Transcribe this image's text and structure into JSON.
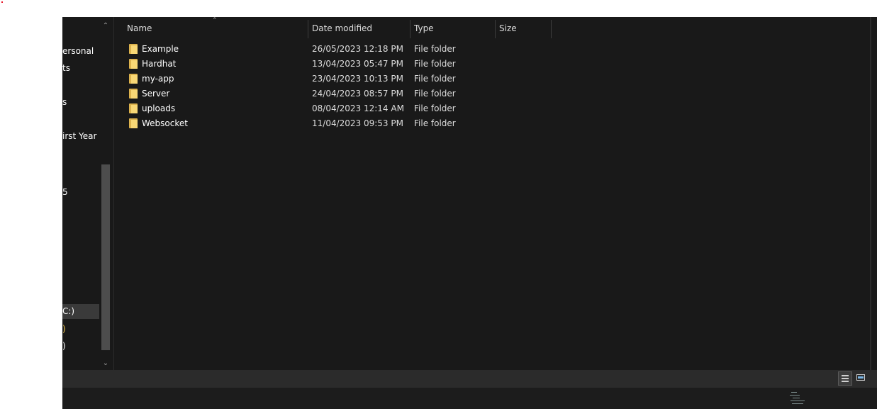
{
  "nav": {
    "items": [
      {
        "label": "ersonal"
      },
      {
        "label": "ts"
      },
      {
        "label": "s"
      },
      {
        "label": "irst Year"
      },
      {
        "label": "5"
      },
      {
        "label": "C:)",
        "selected": true
      },
      {
        "label": ")"
      },
      {
        "label": ")"
      }
    ]
  },
  "columns": {
    "name": "Name",
    "date": "Date modified",
    "type": "Type",
    "size": "Size"
  },
  "files": [
    {
      "name": "Example",
      "date": "26/05/2023 12:18 PM",
      "type": "File folder",
      "size": ""
    },
    {
      "name": "Hardhat",
      "date": "13/04/2023 05:47 PM",
      "type": "File folder",
      "size": ""
    },
    {
      "name": "my-app",
      "date": "23/04/2023 10:13 PM",
      "type": "File folder",
      "size": ""
    },
    {
      "name": "Server",
      "date": "24/04/2023 08:57 PM",
      "type": "File folder",
      "size": ""
    },
    {
      "name": "uploads",
      "date": "08/04/2023 12:14 AM",
      "type": "File folder",
      "size": ""
    },
    {
      "name": "Websocket",
      "date": "11/04/2023 09:53 PM",
      "type": "File folder",
      "size": ""
    }
  ],
  "icons": {
    "sort": "chevron-up-icon",
    "folder": "folder-icon",
    "details_view": "details-view-icon",
    "tiles_view": "large-icons-view-icon"
  },
  "colors": {
    "background": "#191919",
    "folder": "#f8d775",
    "text": "#ffffff"
  }
}
